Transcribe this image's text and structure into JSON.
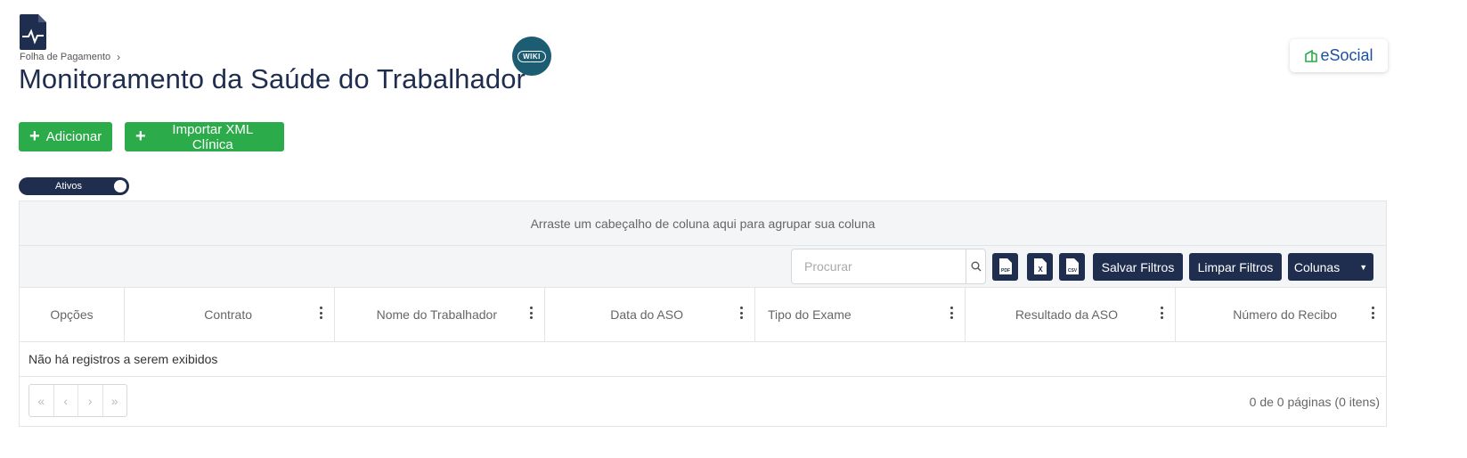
{
  "breadcrumb": {
    "parent": "Folha de Pagamento"
  },
  "page": {
    "title": "Monitoramento da Saúde do Trabalhador",
    "wiki_label": "WIKI"
  },
  "brand": {
    "esocial_label": "eSocial"
  },
  "actions": {
    "add_label": "Adicionar",
    "import_label": "Importar XML Clínica"
  },
  "filter_toggle": {
    "label": "Ativos",
    "on": true
  },
  "grid": {
    "group_panel_text": "Arraste um cabeçalho de coluna aqui para agrupar sua coluna",
    "search_placeholder": "Procurar",
    "export_icons": [
      "pdf-export-icon",
      "excel-export-icon",
      "csv-export-icon"
    ],
    "export_labels": {
      "pdf": "PDF",
      "excel": "X",
      "csv": "CSV"
    },
    "save_filters_label": "Salvar Filtros",
    "clear_filters_label": "Limpar Filtros",
    "columns_label": "Colunas",
    "columns": [
      {
        "label": "Opções"
      },
      {
        "label": "Contrato"
      },
      {
        "label": "Nome do Trabalhador"
      },
      {
        "label": "Data do ASO"
      },
      {
        "label": "Tipo do Exame"
      },
      {
        "label": "Resultado da ASO"
      },
      {
        "label": "Número do Recibo"
      }
    ],
    "empty_text": "Não há registros a serem exibidos",
    "pager": {
      "first": "«",
      "prev": "‹",
      "next": "›",
      "last": "»"
    },
    "pager_info": "0 de 0 páginas (0 itens)"
  },
  "colors": {
    "primary": "#1f2d4e",
    "success": "#2cab4a",
    "wiki": "#1d5d73"
  }
}
